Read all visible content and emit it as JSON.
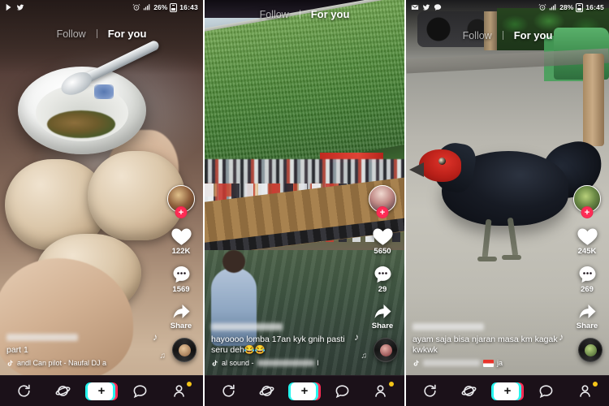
{
  "app": {
    "name": "TikTok",
    "accent_primary": "#fe2c55",
    "accent_secondary": "#25f4ee",
    "navbar_bg": "#1b1119"
  },
  "header": {
    "follow_label": "Follow",
    "foryou_label": "For you"
  },
  "bottom_nav": {
    "home_icon": "home-refresh-icon",
    "discover_icon": "discover-planet-icon",
    "create_label": "+",
    "inbox_icon": "inbox-message-icon",
    "profile_icon": "profile-person-icon"
  },
  "icons": {
    "heart": "heart-icon",
    "comment": "comment-bubble-icon",
    "share": "share-arrow-icon",
    "music_note": "music-note-icon",
    "plus_follow": "+",
    "avatar": "creator-avatar",
    "record_disc": "music-disc-icon"
  },
  "panels": [
    {
      "id": "panel-1",
      "subject": "bowl-of-food-and-bread",
      "status_bar": {
        "icons": [
          "play-store-icon",
          "twitter-icon"
        ],
        "alarm_icon": "alarm-icon",
        "signal_icon": "signal-icon",
        "battery_percent": "26%",
        "time": "16:43"
      },
      "actions": {
        "like_count": "122K",
        "comment_count": "1569",
        "share_label": "Share"
      },
      "caption": {
        "username_blurred": true,
        "text": "part 1",
        "music": "andl Can pilot - Naufal   DJ a"
      }
    },
    {
      "id": "panel-2",
      "subject": "tug-of-war-on-floating-dock",
      "status_bar": null,
      "actions": {
        "like_count": "5650",
        "comment_count": "29",
        "share_label": "Share"
      },
      "caption": {
        "username_blurred": true,
        "text": "hayoooo lomba 17an kyk gnih pasti seru deh😂😂",
        "music": "al sound -",
        "music_suffix": "l"
      }
    },
    {
      "id": "panel-3",
      "subject": "black-rooster-on-road",
      "status_bar": {
        "icons": [
          "mail-icon",
          "twitter-icon",
          "chat-icon"
        ],
        "alarm_icon": "alarm-icon",
        "signal_icon": "signal-icon",
        "battery_percent": "28%",
        "time": "16:45"
      },
      "actions": {
        "like_count": "245K",
        "comment_count": "269",
        "share_label": "Share"
      },
      "caption": {
        "username_blurred": true,
        "text": "ayam saja bisa njaran masa km kagak kwkwk",
        "music": "",
        "music_suffix": "ja"
      }
    }
  ]
}
